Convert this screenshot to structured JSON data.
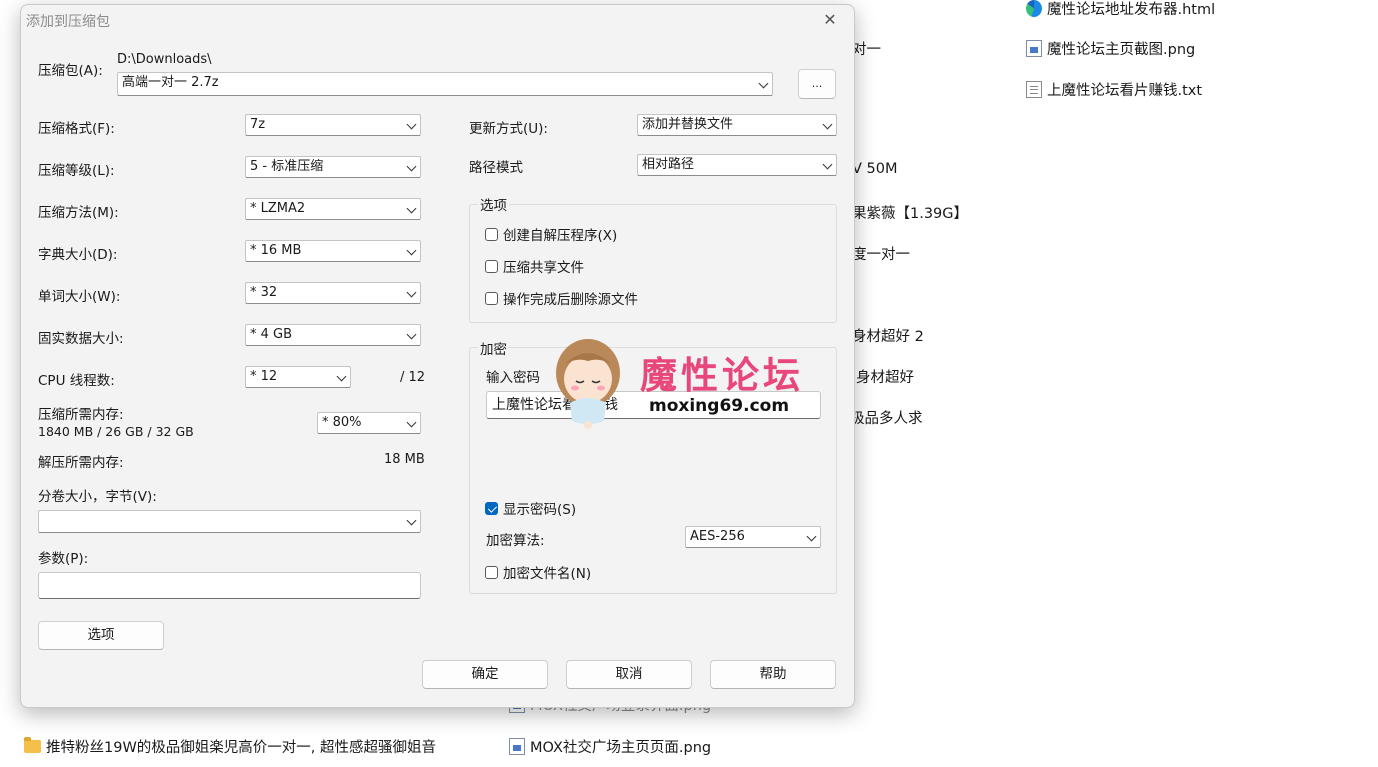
{
  "explorer": {
    "items": [
      {
        "name": "魔性论坛地址发布器.html",
        "icon": "edge-icon"
      },
      {
        "name": "魔性论坛主页截图.png",
        "icon": "png-file-icon"
      },
      {
        "name": "上魔性论坛看片赚钱.txt",
        "icon": "txt-file-icon"
      },
      {
        "name": "推特粉丝19W的极品御姐楽児高价一对一, 超性感超骚御姐音",
        "icon": "folder-icon"
      },
      {
        "name": "MOX社交广场主页页面.png",
        "icon": "png-file-icon"
      },
      {
        "name": "MOX社交广场登录界面.png",
        "icon": "png-file-icon"
      }
    ],
    "fragments": [
      "对一",
      "V 50M",
      "果紫薇【1.39G】",
      "度一对一",
      "身材超好 2",
      "身材超好",
      "极品多人求"
    ]
  },
  "dialog": {
    "title": "添加到压缩包",
    "archive_label": "压缩包(A):",
    "archive_path": "D:\\Downloads\\",
    "archive_name": "高端一对一 2.7z",
    "browse_label": "...",
    "format_label": "压缩格式(F):",
    "format_value": "7z",
    "level_label": "压缩等级(L):",
    "level_value": "5 - 标准压缩",
    "method_label": "压缩方法(M):",
    "method_value": "*  LZMA2",
    "dict_label": "字典大小(D):",
    "dict_value": "*  16 MB",
    "word_label": "单词大小(W):",
    "word_value": "*  32",
    "solid_label": "固实数据大小:",
    "solid_value": "*  4 GB",
    "threads_label": "CPU 线程数:",
    "threads_value": "*  12",
    "threads_max": "/ 12",
    "mem_compress_label": "压缩所需内存:",
    "mem_compress_value": "1840 MB / 26 GB / 32 GB",
    "mem_percent": "*  80%",
    "mem_decompress_label": "解压所需内存:",
    "mem_decompress_value": "18 MB",
    "volume_label": "分卷大小，字节(V):",
    "volume_value": "",
    "params_label": "参数(P):",
    "params_value": "",
    "options_button": "选项",
    "update_label": "更新方式(U):",
    "update_value": "添加并替换文件",
    "path_label": "路径模式",
    "path_value": "相对路径",
    "options_group": "选项",
    "opt_sfx": "创建自解压程序(X)",
    "opt_shared": "压缩共享文件",
    "opt_delete": "操作完成后删除源文件",
    "encrypt_group": "加密",
    "password_label": "输入密码",
    "password_value": "上魔性论坛看片赚钱",
    "show_password": "显示密码(S)",
    "algo_label": "加密算法:",
    "algo_value": "AES-256",
    "encrypt_names": "加密文件名(N)",
    "ok": "确定",
    "cancel": "取消",
    "help": "帮助"
  },
  "watermark": {
    "title": "魔性论坛",
    "url": "moxing69.com"
  },
  "colors": {
    "accent": "#0067c0",
    "watermark": "#e8477b",
    "dialog_bg": "#f3f3f3"
  }
}
